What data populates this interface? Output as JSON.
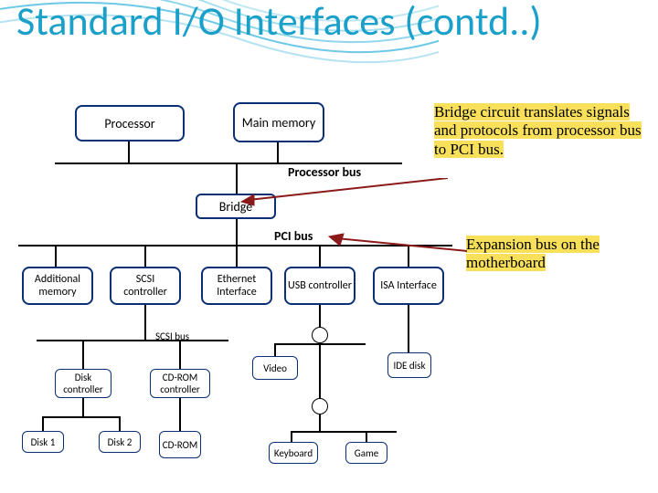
{
  "title": "Standard I/O Interfaces (contd..)",
  "diagram": {
    "processor": "Processor",
    "main_memory": "Main memory",
    "processor_bus": "Processor bus",
    "bridge": "Bridge",
    "pci_bus": "PCI bus",
    "additional_memory": "Additional memory",
    "scsi_controller": "SCSI controller",
    "ethernet": "Ethernet Interface",
    "usb": "USB controller",
    "isa": "ISA Interface",
    "scsi_bus": "SCSI bus",
    "video": "Video",
    "ide_disk": "IDE disk",
    "disk_controller": "Disk controller",
    "cdrom_controller": "CD-ROM controller",
    "disk1": "Disk 1",
    "disk2": "Disk 2",
    "cdrom": "CD-ROM",
    "keyboard": "Keyboard",
    "game": "Game"
  },
  "notes": {
    "bridge_note": "Bridge circuit translates signals and protocols from processor bus to PCI bus.",
    "pci_note": "Expansion bus on the motherboard"
  },
  "chart_data": {
    "type": "diagram",
    "title": "Standard I/O Interfaces (contd..)",
    "nodes": [
      {
        "id": "processor",
        "label": "Processor"
      },
      {
        "id": "main_memory",
        "label": "Main memory"
      },
      {
        "id": "processor_bus",
        "label": "Processor bus",
        "type": "bus"
      },
      {
        "id": "bridge",
        "label": "Bridge"
      },
      {
        "id": "pci_bus",
        "label": "PCI bus",
        "type": "bus"
      },
      {
        "id": "additional_memory",
        "label": "Additional memory"
      },
      {
        "id": "scsi_controller",
        "label": "SCSI controller"
      },
      {
        "id": "ethernet",
        "label": "Ethernet Interface"
      },
      {
        "id": "usb",
        "label": "USB controller"
      },
      {
        "id": "isa",
        "label": "ISA Interface"
      },
      {
        "id": "scsi_bus",
        "label": "SCSI bus",
        "type": "bus"
      },
      {
        "id": "video",
        "label": "Video"
      },
      {
        "id": "ide_disk",
        "label": "IDE disk"
      },
      {
        "id": "disk_controller",
        "label": "Disk controller"
      },
      {
        "id": "cdrom_controller",
        "label": "CD-ROM controller"
      },
      {
        "id": "disk1",
        "label": "Disk 1"
      },
      {
        "id": "disk2",
        "label": "Disk 2"
      },
      {
        "id": "cdrom",
        "label": "CD-ROM"
      },
      {
        "id": "keyboard",
        "label": "Keyboard"
      },
      {
        "id": "game",
        "label": "Game"
      }
    ],
    "edges": [
      {
        "from": "processor",
        "to": "processor_bus"
      },
      {
        "from": "main_memory",
        "to": "processor_bus"
      },
      {
        "from": "processor_bus",
        "to": "bridge"
      },
      {
        "from": "bridge",
        "to": "pci_bus"
      },
      {
        "from": "pci_bus",
        "to": "additional_memory"
      },
      {
        "from": "pci_bus",
        "to": "scsi_controller"
      },
      {
        "from": "pci_bus",
        "to": "ethernet"
      },
      {
        "from": "pci_bus",
        "to": "usb"
      },
      {
        "from": "pci_bus",
        "to": "isa"
      },
      {
        "from": "scsi_controller",
        "to": "scsi_bus"
      },
      {
        "from": "scsi_bus",
        "to": "disk_controller"
      },
      {
        "from": "scsi_bus",
        "to": "cdrom_controller"
      },
      {
        "from": "disk_controller",
        "to": "disk1"
      },
      {
        "from": "disk_controller",
        "to": "disk2"
      },
      {
        "from": "cdrom_controller",
        "to": "cdrom"
      },
      {
        "from": "usb",
        "to": "video"
      },
      {
        "from": "usb",
        "to": "keyboard"
      },
      {
        "from": "isa",
        "to": "ide_disk"
      },
      {
        "from": "isa",
        "to": "game"
      }
    ],
    "annotations": [
      {
        "target": "bridge",
        "text": "Bridge circuit translates signals and protocols from processor bus to PCI bus."
      },
      {
        "target": "pci_bus",
        "text": "Expansion bus on the motherboard"
      }
    ]
  }
}
